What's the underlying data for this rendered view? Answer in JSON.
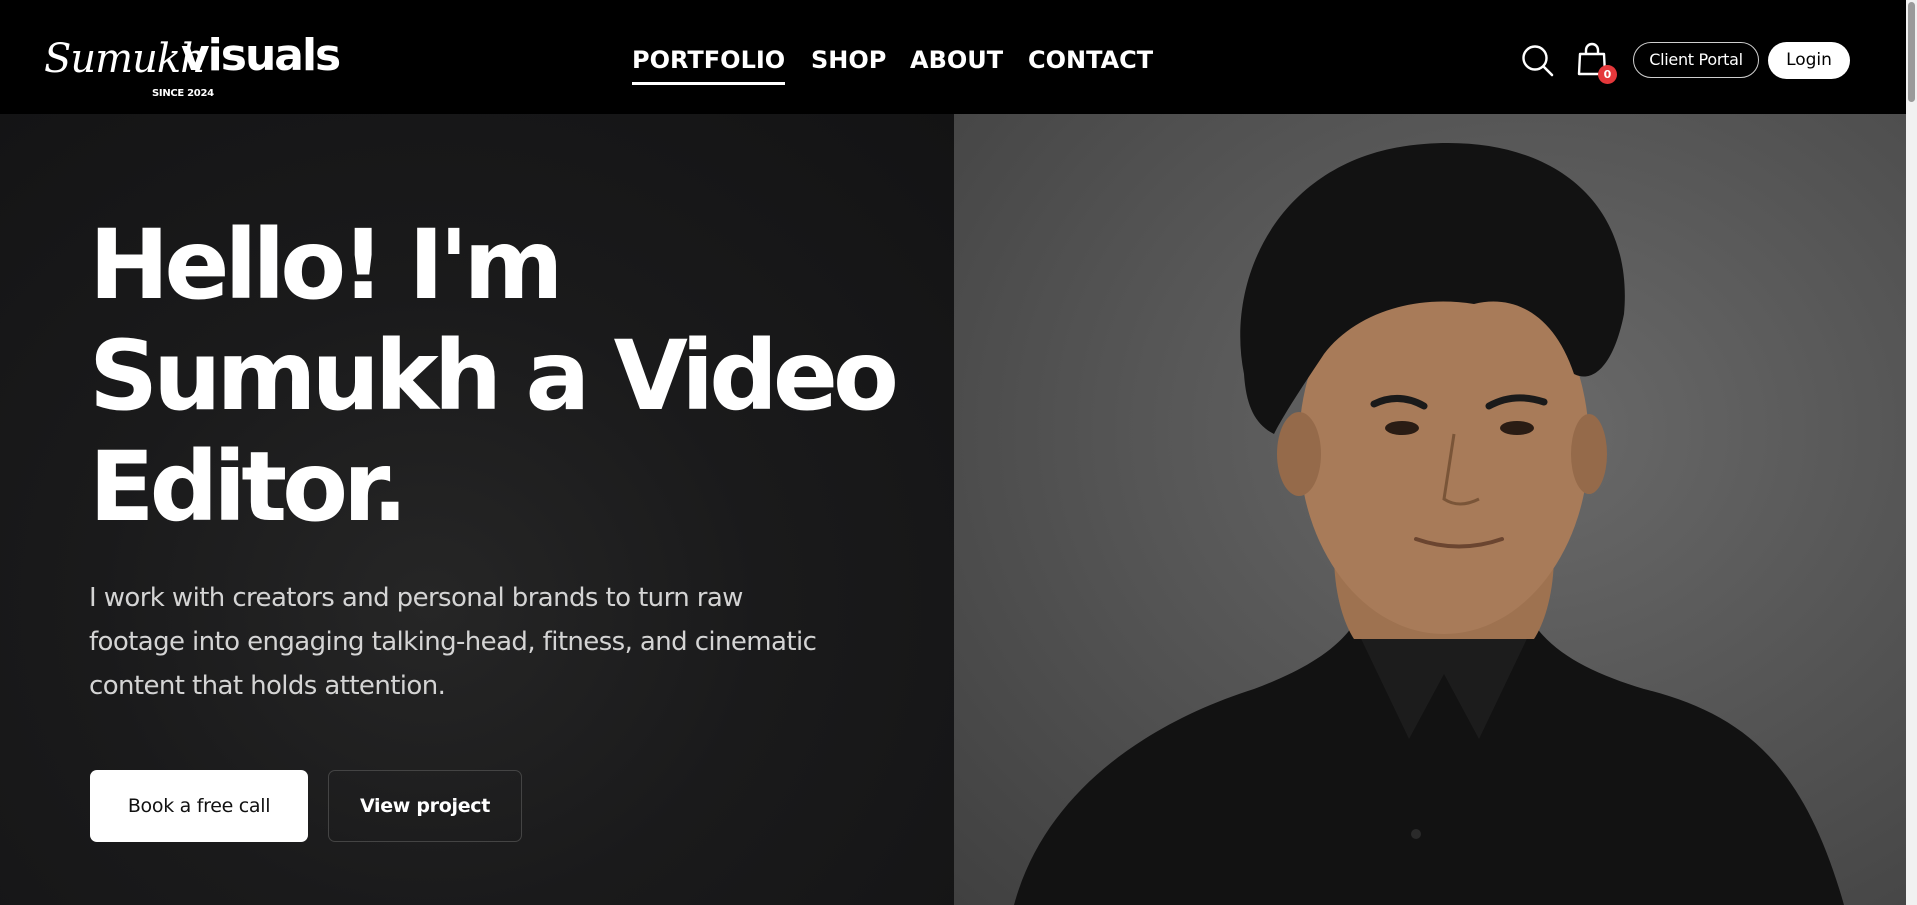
{
  "brand": {
    "name_script": "Sumukh",
    "name_bold": "visuals",
    "tagline": "SINCE 2024"
  },
  "nav": {
    "items": [
      {
        "label": "PORTFOLIO",
        "active": true
      },
      {
        "label": "SHOP",
        "active": false
      },
      {
        "label": "ABOUT",
        "active": false
      },
      {
        "label": "CONTACT",
        "active": false
      }
    ]
  },
  "header_actions": {
    "search_icon": "search-icon",
    "cart_icon": "shopping-bag-icon",
    "cart_count": "0",
    "client_portal_label": "Client Portal",
    "login_label": "Login"
  },
  "hero": {
    "title": "Hello!  I'm Sumukh a Video Editor.",
    "description": "I work with creators and personal brands to turn raw footage into engaging talking-head, fitness, and cinematic content that holds attention.",
    "primary_cta": "Book a free call",
    "secondary_cta": "View project",
    "portrait": "portrait-photo"
  },
  "colors": {
    "background": "#000000",
    "hero_panel": "#161617",
    "badge": "#e5383b",
    "button_light": "#ffffff"
  }
}
